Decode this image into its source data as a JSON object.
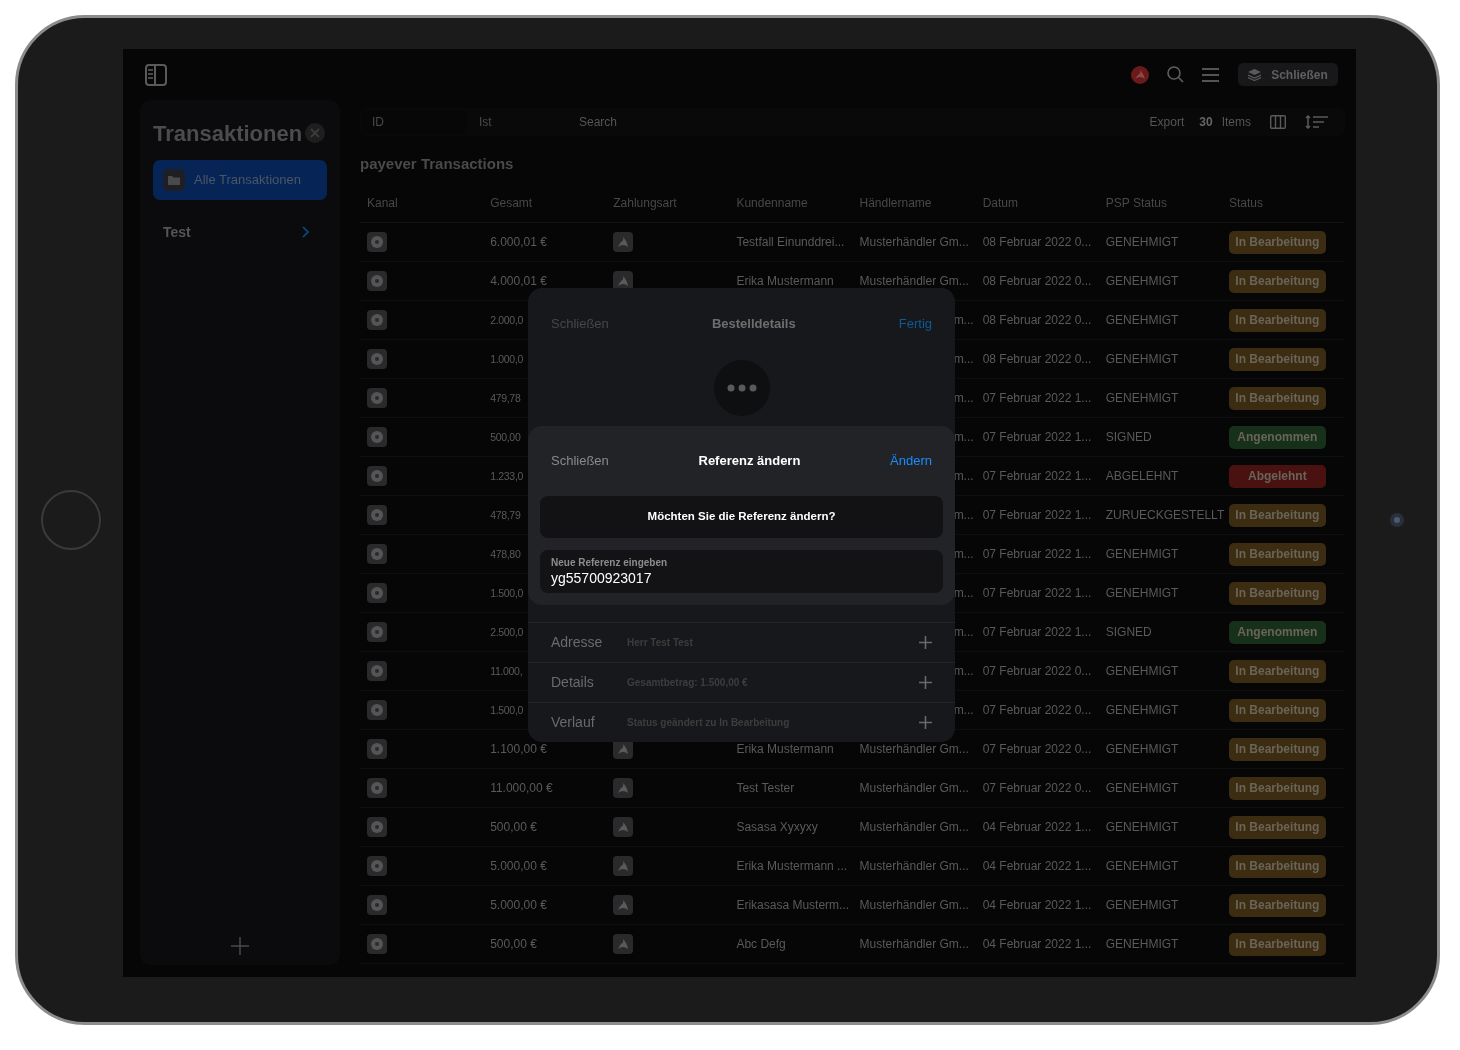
{
  "top_bar": {
    "close_button": "Schließen"
  },
  "sidebar": {
    "title": "Transaktionen",
    "items": [
      {
        "label": "Alle Transaktionen",
        "kind": "folder",
        "selected": true
      },
      {
        "label": "Test",
        "kind": "group",
        "selected": false
      }
    ]
  },
  "toolbar": {
    "id_placeholder": "ID",
    "filter": "Ist",
    "search_placeholder": "Search",
    "export": "Export",
    "count": "30",
    "count_label": "Items"
  },
  "table": {
    "title": "payever Transactions",
    "columns": [
      "Kanal",
      "Gesamt",
      "Zahlungsart",
      "Kundenname",
      "Händlername",
      "Datum",
      "PSP Status",
      "Status"
    ],
    "rows": [
      {
        "total": "6.000,01 €",
        "covered": false,
        "customer": "Testfall Einunddrei...",
        "merchant": "Musterhändler Gm...",
        "date": "08 Februar 2022 0...",
        "psp": "GENEHMIGT",
        "status": "In Bearbeitung",
        "color": "#3b2c12"
      },
      {
        "total": "4.000,01 €",
        "covered": false,
        "customer": "Erika Mustermann",
        "merchant": "Musterhändler Gm...",
        "date": "08 Februar 2022 0...",
        "psp": "GENEHMIGT",
        "status": "In Bearbeitung",
        "color": "#3b2c12"
      },
      {
        "total": "2.000,0",
        "covered": true,
        "merchant": "m...",
        "date": "08 Februar 2022 0...",
        "psp": "GENEHMIGT",
        "status": "In Bearbeitung",
        "color": "#3b2c12"
      },
      {
        "total": "1.000,0",
        "covered": true,
        "merchant": "m...",
        "date": "08 Februar 2022 0...",
        "psp": "GENEHMIGT",
        "status": "In Bearbeitung",
        "color": "#3b2c12"
      },
      {
        "total": "479,78",
        "covered": true,
        "merchant": "m...",
        "date": "07 Februar 2022 1...",
        "psp": "GENEHMIGT",
        "status": "In Bearbeitung",
        "color": "#3b2c12"
      },
      {
        "total": "500,00",
        "covered": true,
        "merchant": "m...",
        "date": "07 Februar 2022 1...",
        "psp": "SIGNED",
        "status": "Angenommen",
        "color": "#173019"
      },
      {
        "total": "1.233,0",
        "covered": true,
        "merchant": "m...",
        "date": "07 Februar 2022 1...",
        "psp": "ABGELEHNT",
        "status": "Abgelehnt",
        "color": "#4a1111"
      },
      {
        "total": "478,79",
        "covered": true,
        "merchant": "m...",
        "date": "07 Februar 2022 1...",
        "psp": "ZURUECKGESTELLT",
        "status": "In Bearbeitung",
        "color": "#3b2c12"
      },
      {
        "total": "478,80",
        "covered": true,
        "merchant": "m...",
        "date": "07 Februar 2022 1...",
        "psp": "GENEHMIGT",
        "status": "In Bearbeitung",
        "color": "#3b2c12"
      },
      {
        "total": "1.500,0",
        "covered": true,
        "merchant": "m...",
        "date": "07 Februar 2022 1...",
        "psp": "GENEHMIGT",
        "status": "In Bearbeitung",
        "color": "#3b2c12"
      },
      {
        "total": "2.500,0",
        "covered": true,
        "merchant": "m...",
        "date": "07 Februar 2022 1...",
        "psp": "SIGNED",
        "status": "Angenommen",
        "color": "#173019"
      },
      {
        "total": "11.000,",
        "covered": true,
        "merchant": "m...",
        "date": "07 Februar 2022 0...",
        "psp": "GENEHMIGT",
        "status": "In Bearbeitung",
        "color": "#3b2c12"
      },
      {
        "total": "1.500,0",
        "covered": true,
        "merchant": "m...",
        "date": "07 Februar 2022 0...",
        "psp": "GENEHMIGT",
        "status": "In Bearbeitung",
        "color": "#3b2c12"
      },
      {
        "total": "1.100,00 €",
        "covered": false,
        "customer": "Erika Mustermann",
        "merchant": "Musterhändler Gm...",
        "date": "07 Februar 2022 0...",
        "psp": "GENEHMIGT",
        "status": "In Bearbeitung",
        "color": "#3b2c12"
      },
      {
        "total": "11.000,00 €",
        "covered": false,
        "customer": "Test Tester",
        "merchant": "Musterhändler Gm...",
        "date": "07 Februar 2022 0...",
        "psp": "GENEHMIGT",
        "status": "In Bearbeitung",
        "color": "#3b2c12"
      },
      {
        "total": "500,00 €",
        "covered": false,
        "customer": "Sasasa Xyxyxy",
        "merchant": "Musterhändler Gm...",
        "date": "04 Februar 2022 1...",
        "psp": "GENEHMIGT",
        "status": "In Bearbeitung",
        "color": "#3b2c12"
      },
      {
        "total": "5.000,00 €",
        "covered": false,
        "customer": "Erika Mustermann ...",
        "merchant": "Musterhändler Gm...",
        "date": "04 Februar 2022 1...",
        "psp": "GENEHMIGT",
        "status": "In Bearbeitung",
        "color": "#3b2c12"
      },
      {
        "total": "5.000,00 €",
        "covered": false,
        "customer": "Erikasasa Musterm...",
        "merchant": "Musterhändler Gm...",
        "date": "04 Februar 2022 1...",
        "psp": "GENEHMIGT",
        "status": "In Bearbeitung",
        "color": "#3b2c12"
      },
      {
        "total": "500,00 €",
        "covered": false,
        "customer": "Abc Defg",
        "merchant": "Musterhändler Gm...",
        "date": "04 Februar 2022 1...",
        "psp": "GENEHMIGT",
        "status": "In Bearbeitung",
        "color": "#3b2c12"
      }
    ]
  },
  "order_modal": {
    "close": "Schließen",
    "title": "Bestelldetails",
    "done": "Fertig",
    "sections": [
      {
        "label": "Adresse",
        "value": "Herr Test Test"
      },
      {
        "label": "Details",
        "value": "Gesamtbetrag: 1.500,00 €"
      },
      {
        "label": "Verlauf",
        "value": "Status geändert zu In Bearbeitung"
      }
    ]
  },
  "reference_dialog": {
    "close": "Schließen",
    "title": "Referenz ändern",
    "confirm": "Ändern",
    "message": "Möchten Sie die Referenz ändern?",
    "field": {
      "label": "Neue Referenz eingeben",
      "value": "yg55700923017"
    }
  }
}
